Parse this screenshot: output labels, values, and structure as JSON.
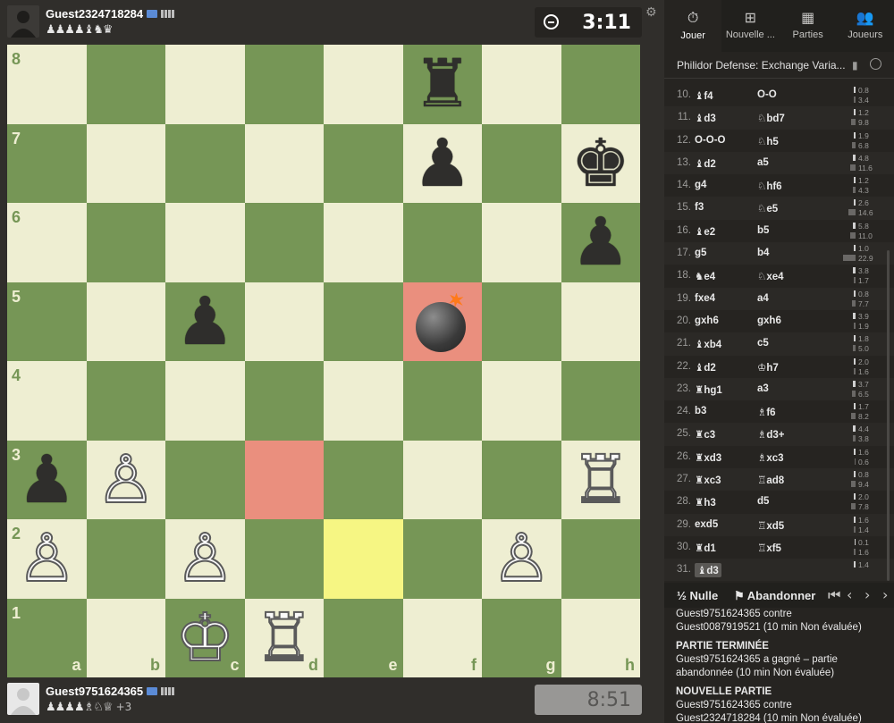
{
  "top_player": {
    "name": "Guest2324718284",
    "captured": "♟♟♟♟♝♞♛",
    "clock": "3:11"
  },
  "bottom_player": {
    "name": "Guest9751624365",
    "captured": "♟♟♟♟♗♘♕",
    "plus": "+3",
    "clock": "8:51"
  },
  "board": {
    "ranks": [
      "8",
      "7",
      "6",
      "5",
      "4",
      "3",
      "2",
      "1"
    ],
    "files": [
      "a",
      "b",
      "c",
      "d",
      "e",
      "f",
      "g",
      "h"
    ],
    "pieces": [
      {
        "sq": "f8",
        "glyph": "♜",
        "color": "b"
      },
      {
        "sq": "f7",
        "glyph": "♟",
        "color": "b"
      },
      {
        "sq": "h7",
        "glyph": "♚",
        "color": "b"
      },
      {
        "sq": "h6",
        "glyph": "♟",
        "color": "b"
      },
      {
        "sq": "c5",
        "glyph": "♟",
        "color": "b"
      },
      {
        "sq": "a3",
        "glyph": "♟",
        "color": "b"
      },
      {
        "sq": "b3",
        "glyph": "♙",
        "color": "w"
      },
      {
        "sq": "h3",
        "glyph": "♖",
        "color": "w"
      },
      {
        "sq": "a2",
        "glyph": "♙",
        "color": "w"
      },
      {
        "sq": "c2",
        "glyph": "♙",
        "color": "w"
      },
      {
        "sq": "g2",
        "glyph": "♙",
        "color": "w"
      },
      {
        "sq": "c1",
        "glyph": "♔",
        "color": "w"
      },
      {
        "sq": "d1",
        "glyph": "♖",
        "color": "w"
      }
    ],
    "highlight_red": [
      "f5",
      "d3"
    ],
    "highlight_yellow": [
      "e2"
    ],
    "bomb_square": "f5"
  },
  "tabs": [
    {
      "icon": "⏱",
      "label": "Jouer",
      "active": true
    },
    {
      "icon": "⊞",
      "label": "Nouvelle ...",
      "active": false
    },
    {
      "icon": "▦",
      "label": "Parties",
      "active": false
    },
    {
      "icon": "👥",
      "label": "Joueurs",
      "active": false
    }
  ],
  "opening": "Philidor Defense: Exchange Varia...",
  "moves": [
    {
      "n": "10.",
      "wp": "♝",
      "w": "f4",
      "bp": "",
      "b": "O-O",
      "t1": "0.8",
      "t2": "3.4",
      "w1": 2,
      "w2": 2
    },
    {
      "n": "11.",
      "wp": "♝",
      "w": "d3",
      "bp": "♘",
      "b": "bd7",
      "t1": "1.2",
      "t2": "9.8",
      "w1": 2,
      "w2": 5
    },
    {
      "n": "12.",
      "wp": "",
      "w": "O-O-O",
      "bp": "♘",
      "b": "h5",
      "t1": "1.9",
      "t2": "6.8",
      "w1": 2,
      "w2": 4
    },
    {
      "n": "13.",
      "wp": "♝",
      "w": "d2",
      "bp": "",
      "b": "a5",
      "t1": "4.8",
      "t2": "11.6",
      "w1": 3,
      "w2": 6
    },
    {
      "n": "14.",
      "wp": "",
      "w": "g4",
      "bp": "♘",
      "b": "hf6",
      "t1": "1.2",
      "t2": "4.3",
      "w1": 2,
      "w2": 3
    },
    {
      "n": "15.",
      "wp": "",
      "w": "f3",
      "bp": "♘",
      "b": "e5",
      "t1": "2.6",
      "t2": "14.6",
      "w1": 2,
      "w2": 8
    },
    {
      "n": "16.",
      "wp": "♝",
      "w": "e2",
      "bp": "",
      "b": "b5",
      "t1": "5.8",
      "t2": "11.0",
      "w1": 3,
      "w2": 6
    },
    {
      "n": "17.",
      "wp": "",
      "w": "g5",
      "bp": "",
      "b": "b4",
      "t1": "1.0",
      "t2": "22.9",
      "w1": 2,
      "w2": 14
    },
    {
      "n": "18.",
      "wp": "♞",
      "w": "e4",
      "bp": "♘",
      "b": "xe4",
      "t1": "3.8",
      "t2": "1.7",
      "w1": 3,
      "w2": 2
    },
    {
      "n": "19.",
      "wp": "",
      "w": "fxe4",
      "bp": "",
      "b": "a4",
      "t1": "0.8",
      "t2": "7.7",
      "w1": 2,
      "w2": 4
    },
    {
      "n": "20.",
      "wp": "",
      "w": "gxh6",
      "bp": "",
      "b": "gxh6",
      "t1": "3.9",
      "t2": "1.9",
      "w1": 3,
      "w2": 2
    },
    {
      "n": "21.",
      "wp": "♝",
      "w": "xb4",
      "bp": "",
      "b": "c5",
      "t1": "1.8",
      "t2": "5.0",
      "w1": 2,
      "w2": 3
    },
    {
      "n": "22.",
      "wp": "♝",
      "w": "d2",
      "bp": "♔",
      "b": "h7",
      "t1": "2.0",
      "t2": "1.6",
      "w1": 2,
      "w2": 2
    },
    {
      "n": "23.",
      "wp": "♜",
      "w": "hg1",
      "bp": "",
      "b": "a3",
      "t1": "3.7",
      "t2": "6.5",
      "w1": 3,
      "w2": 4
    },
    {
      "n": "24.",
      "wp": "",
      "w": "b3",
      "bp": "♗",
      "b": "f6",
      "t1": "1.7",
      "t2": "8.2",
      "w1": 2,
      "w2": 5
    },
    {
      "n": "25.",
      "wp": "♜",
      "w": "c3",
      "bp": "♗",
      "b": "d3+",
      "t1": "4.4",
      "t2": "3.8",
      "w1": 3,
      "w2": 3
    },
    {
      "n": "26.",
      "wp": "♜",
      "w": "xd3",
      "bp": "♗",
      "b": "xc3",
      "t1": "1.6",
      "t2": "0.6",
      "w1": 2,
      "w2": 1
    },
    {
      "n": "27.",
      "wp": "♜",
      "w": "xc3",
      "bp": "♖",
      "b": "ad8",
      "t1": "0.8",
      "t2": "9.4",
      "w1": 2,
      "w2": 5
    },
    {
      "n": "28.",
      "wp": "♜",
      "w": "h3",
      "bp": "",
      "b": "d5",
      "t1": "2.0",
      "t2": "7.8",
      "w1": 2,
      "w2": 5
    },
    {
      "n": "29.",
      "wp": "",
      "w": "exd5",
      "bp": "♖",
      "b": "xd5",
      "t1": "1.6",
      "t2": "1.4",
      "w1": 2,
      "w2": 2
    },
    {
      "n": "30.",
      "wp": "♜",
      "w": "d1",
      "bp": "♖",
      "b": "xf5",
      "t1": "0.1",
      "t2": "1.6",
      "w1": 1,
      "w2": 2
    },
    {
      "n": "31.",
      "wp": "♝",
      "w": "d3",
      "bp": "",
      "b": "",
      "t1": "1.4",
      "t2": "",
      "w1": 2,
      "w2": 0,
      "current": true
    }
  ],
  "controls": {
    "draw_label": "Nulle",
    "draw_icon": "½",
    "resign_label": "Abandonner"
  },
  "chat": [
    {
      "text": "Guest9751624365 contre",
      "bold": false,
      "hd": false
    },
    {
      "text": "Guest0087919521 (10 min Non évaluée)",
      "bold": false,
      "hd": false
    },
    {
      "text": "PARTIE TERMINÉE",
      "bold": true,
      "hd": true
    },
    {
      "text": "Guest9751624365 a gagné – partie",
      "bold": false,
      "hd": false
    },
    {
      "text": "abandonnée (10 min Non évaluée)",
      "bold": false,
      "hd": false
    },
    {
      "text": "NOUVELLE PARTIE",
      "bold": true,
      "hd": true
    },
    {
      "text": "Guest9751624365 contre",
      "bold": false,
      "hd": false
    },
    {
      "text": "Guest2324718284 (10 min Non évaluée)",
      "bold": false,
      "hd": false
    }
  ]
}
